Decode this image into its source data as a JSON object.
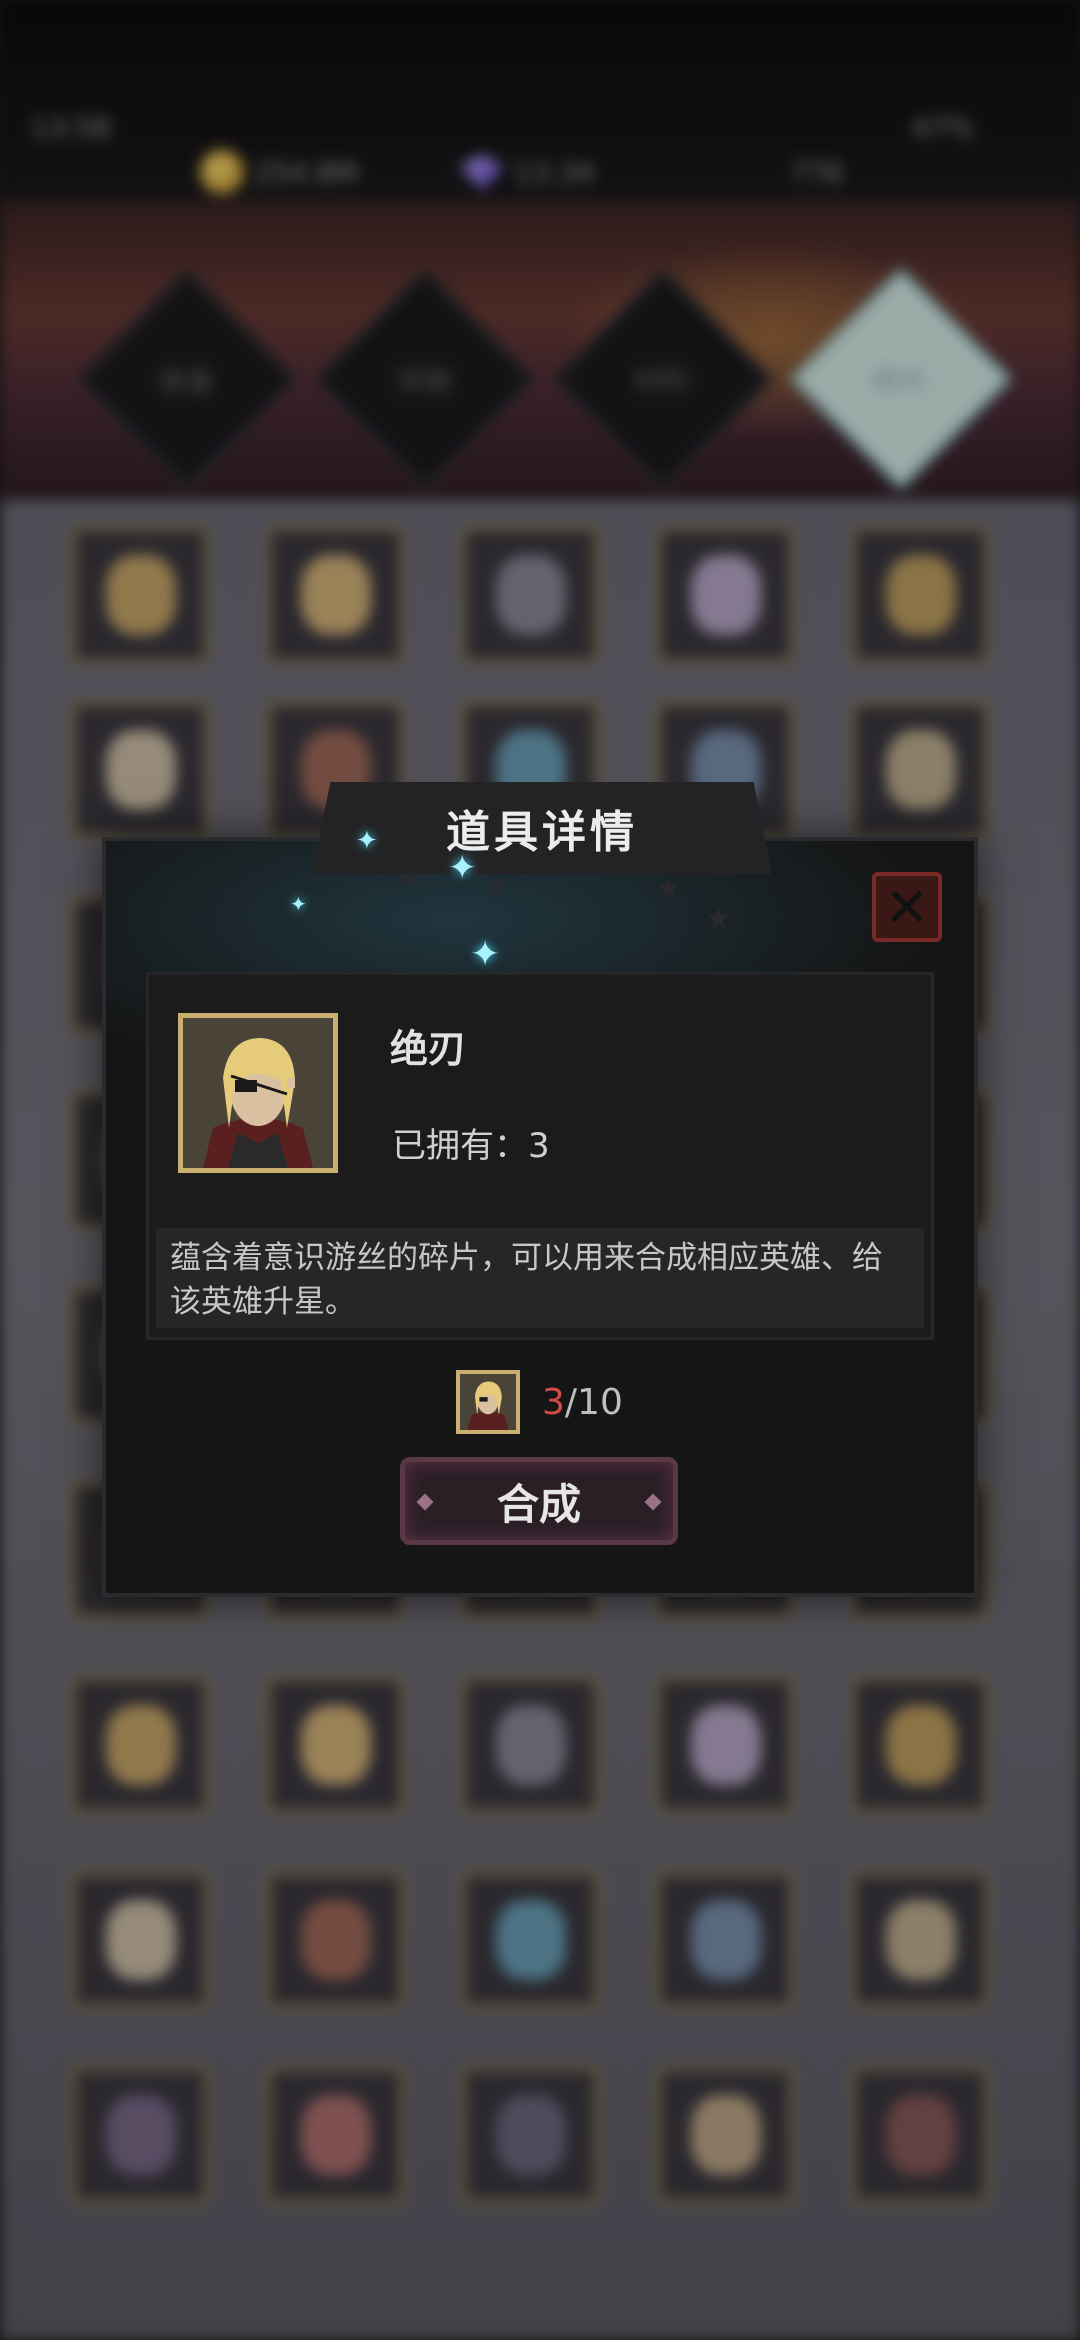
{
  "status_bar": {
    "time": "13:58",
    "battery": "47%"
  },
  "resources": {
    "gold": "254.8M",
    "gems": "13.34",
    "energy": "776"
  },
  "tabs": [
    {
      "label": "装备",
      "selected": false
    },
    {
      "label": "突破",
      "selected": false
    },
    {
      "label": "材料",
      "selected": false
    },
    {
      "label": "碎片",
      "selected": true
    }
  ],
  "dialog": {
    "title": "道具详情",
    "close_icon": "close-icon",
    "item_name": "绝刃",
    "owned_label": "已拥有：",
    "owned_count": "3",
    "description": "蕴含着意识游丝的碎片，可以用来合成相应英雄、给该英雄升星。",
    "progress_current": "3",
    "progress_separator": "/",
    "progress_required": "10",
    "synth_button": "合成"
  },
  "colors": {
    "accent_red": "#d24b45",
    "frame_gold": "#c9b070",
    "dialog_bg": "#151515"
  }
}
